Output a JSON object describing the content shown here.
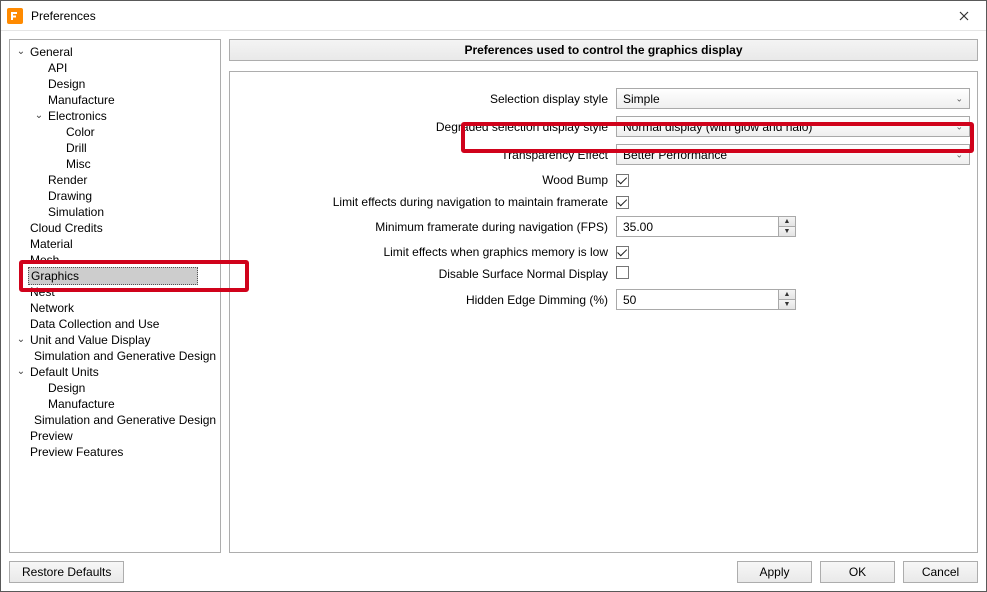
{
  "window": {
    "title": "Preferences"
  },
  "tree": {
    "general": "General",
    "api": "API",
    "design": "Design",
    "manufacture": "Manufacture",
    "electronics": "Electronics",
    "color": "Color",
    "drill": "Drill",
    "misc": "Misc",
    "render": "Render",
    "drawing": "Drawing",
    "simulation": "Simulation",
    "cloud_credits": "Cloud Credits",
    "material": "Material",
    "mesh": "Mesh",
    "graphics": "Graphics",
    "nest": "Nest",
    "network": "Network",
    "data_collection": "Data Collection and Use",
    "unit_value": "Unit and Value Display",
    "sim_gen_design": "Simulation and Generative Design",
    "default_units": "Default Units",
    "du_design": "Design",
    "du_manufacture": "Manufacture",
    "du_sim_gen": "Simulation and Generative Design",
    "preview": "Preview",
    "preview_features": "Preview Features"
  },
  "heading": "Preferences used to control the graphics display",
  "labels": {
    "selection_style": "Selection display style",
    "degraded_style": "Degraded selection display style",
    "transparency": "Transparency Effect",
    "wood_bump": "Wood Bump",
    "limit_effects_nav": "Limit effects during navigation to maintain framerate",
    "min_framerate": "Minimum framerate during navigation (FPS)",
    "limit_effects_mem": "Limit effects when graphics memory is low",
    "disable_normal": "Disable Surface Normal Display",
    "hidden_edge": "Hidden Edge Dimming (%)"
  },
  "values": {
    "selection_style": "Simple",
    "degraded_style": "Normal display (with glow and halo)",
    "transparency": "Better Performance",
    "wood_bump_checked": true,
    "limit_effects_nav_checked": true,
    "min_framerate": "35.00",
    "limit_effects_mem_checked": true,
    "disable_normal_checked": false,
    "hidden_edge": "50"
  },
  "buttons": {
    "restore": "Restore Defaults",
    "apply": "Apply",
    "ok": "OK",
    "cancel": "Cancel"
  },
  "twisty": {
    "expanded": "⌄"
  }
}
